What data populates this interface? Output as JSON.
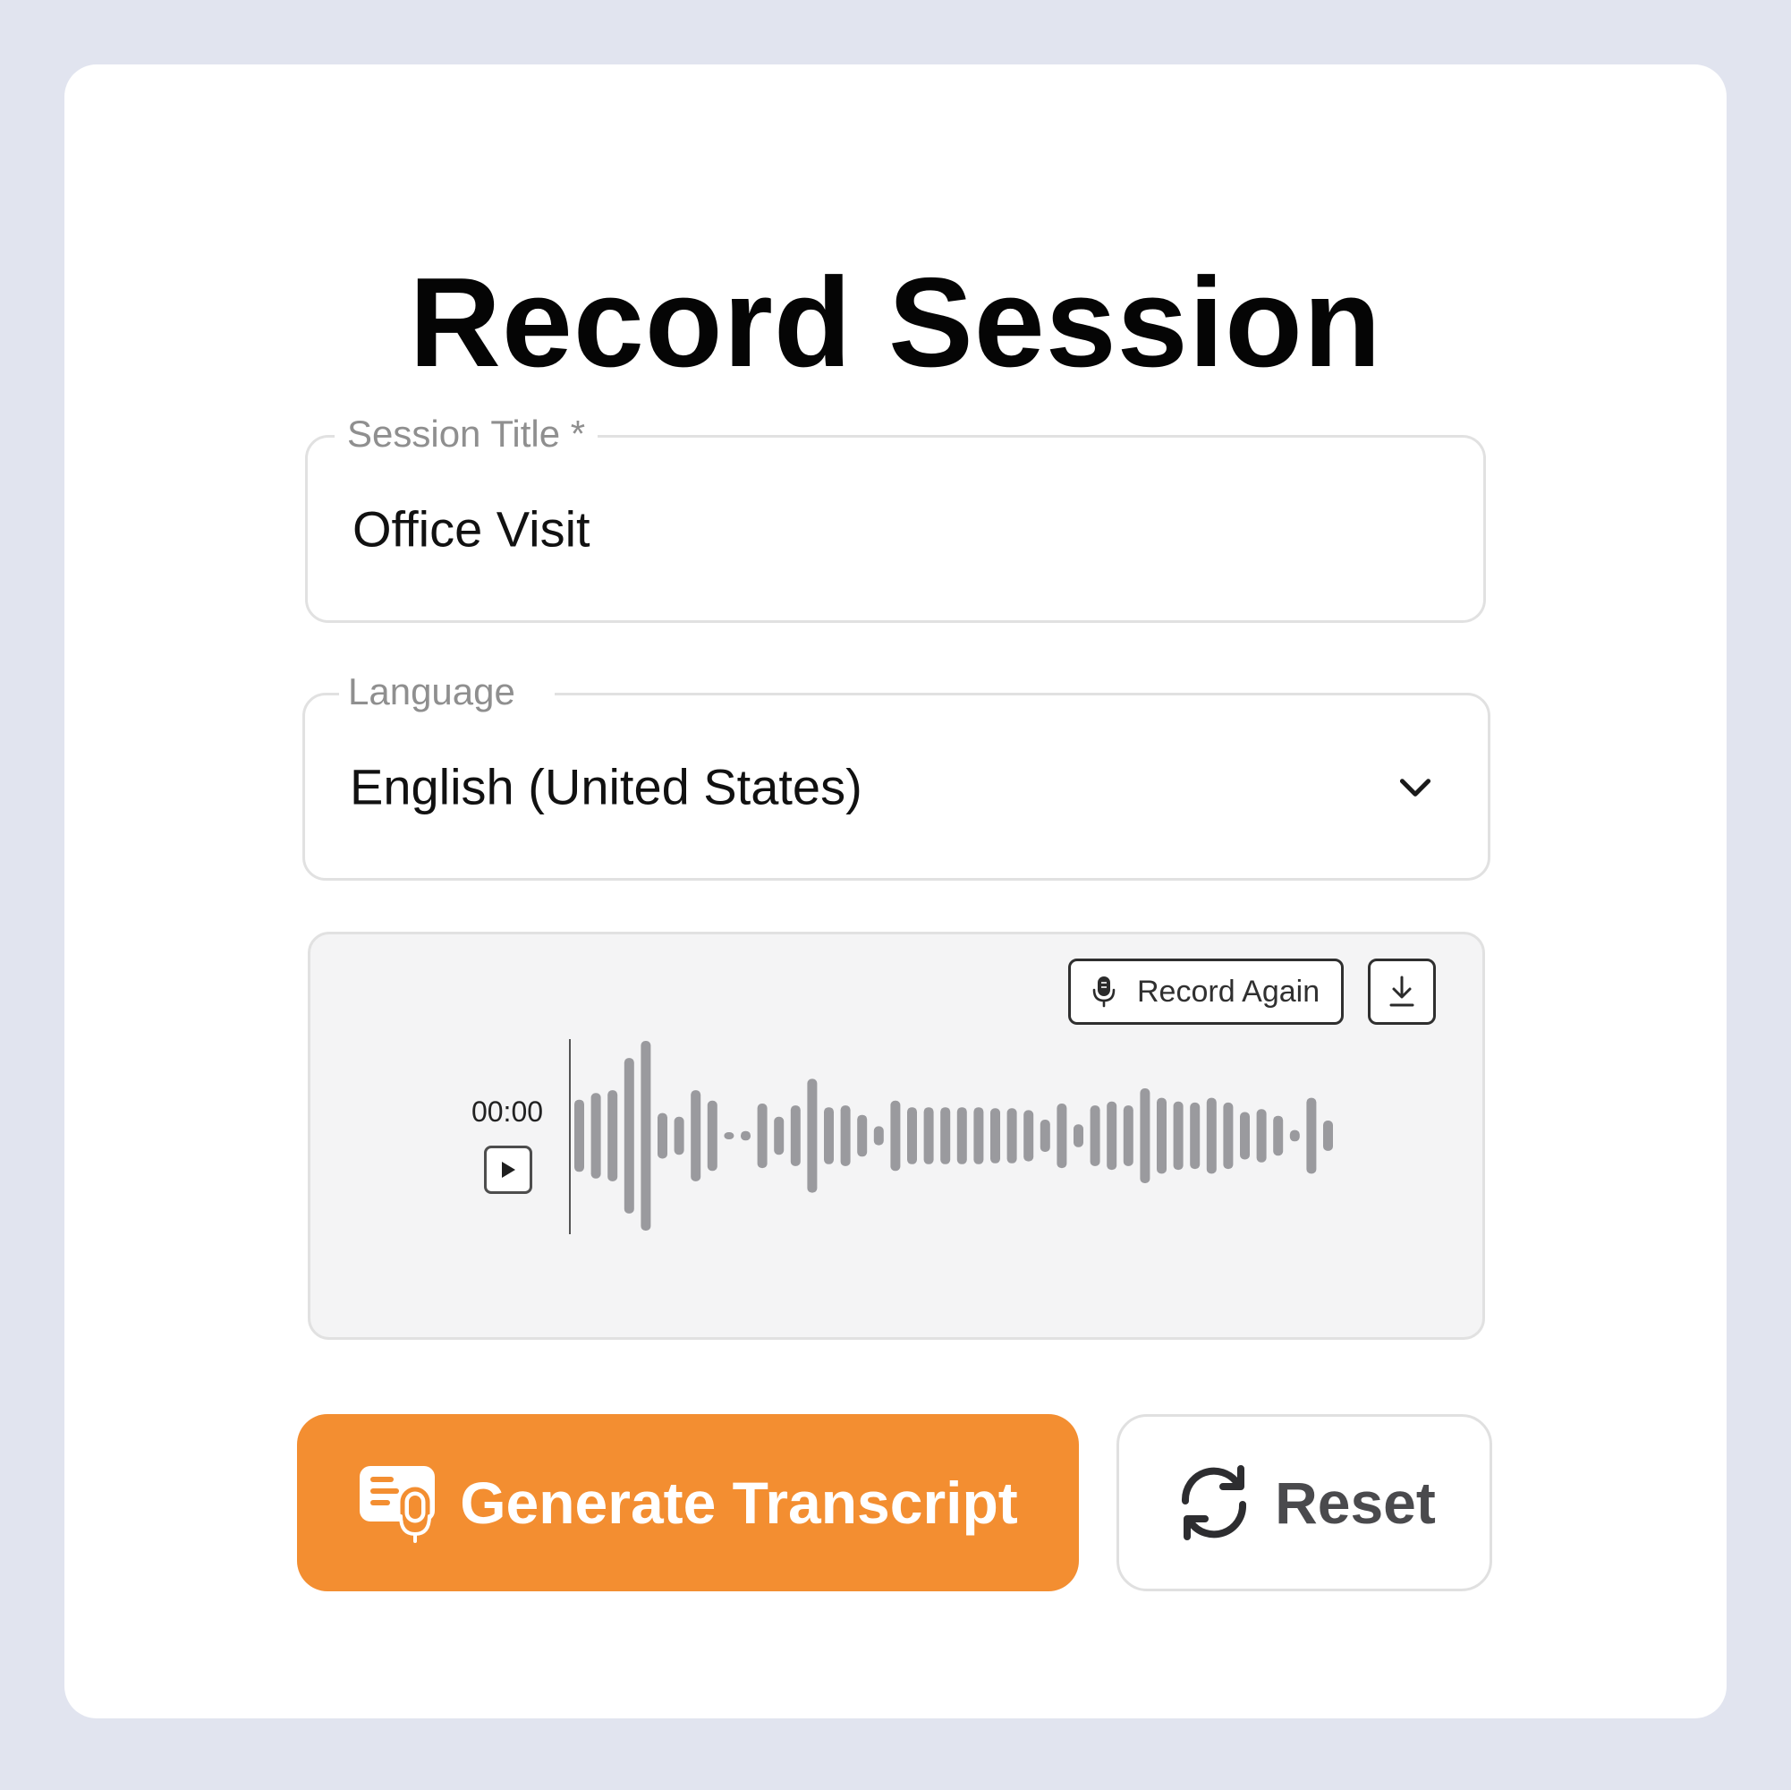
{
  "page": {
    "title": "Record Session"
  },
  "session_title": {
    "label": "Session Title *",
    "value": "Office Visit"
  },
  "language": {
    "label": "Language",
    "selected": "English (United States)",
    "icon": "chevron-down-icon"
  },
  "audio": {
    "record_again_label": "Record Again",
    "record_again_icon": "microphone-icon",
    "download_icon": "download-icon",
    "time": "00:00",
    "play_icon": "play-icon",
    "waveform_heights": [
      0.38,
      0.45,
      0.48,
      0.82,
      1.0,
      0.24,
      0.2,
      0.48,
      0.37,
      0.03,
      0.05,
      0.34,
      0.2,
      0.32,
      0.6,
      0.3,
      0.32,
      0.22,
      0.1,
      0.37,
      0.3,
      0.3,
      0.3,
      0.3,
      0.3,
      0.29,
      0.29,
      0.27,
      0.17,
      0.34,
      0.12,
      0.32,
      0.36,
      0.32,
      0.5,
      0.4,
      0.36,
      0.35,
      0.4,
      0.35,
      0.25,
      0.28,
      0.21,
      0.06,
      0.4,
      0.16
    ]
  },
  "actions": {
    "generate_label": "Generate Transcript",
    "generate_icon": "transcript-mic-icon",
    "reset_label": "Reset",
    "reset_icon": "refresh-icon"
  },
  "colors": {
    "background": "#e1e4ef",
    "accent": "#f38e31",
    "waveform": "#9a9a9e"
  }
}
